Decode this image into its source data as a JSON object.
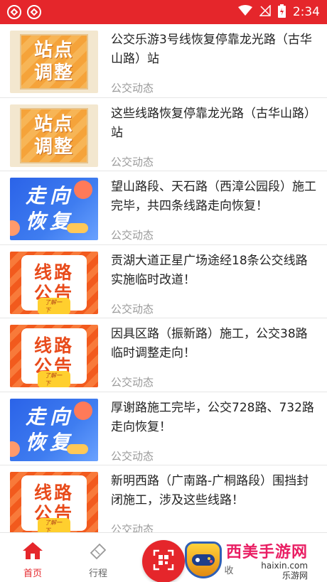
{
  "status_bar": {
    "time": "2:34",
    "icons": [
      "app-notification-icon",
      "app-notification-icon",
      "wifi-icon",
      "signal-off-icon",
      "battery-charging-icon"
    ]
  },
  "news": [
    {
      "title": "公交乐游3号线恢复停靠龙光路（古华山路）站",
      "category": "公交动态",
      "thumb": {
        "type": "station",
        "lines": [
          "站点",
          "调整"
        ]
      }
    },
    {
      "title": "这些线路恢复停靠龙光路（古华山路）站",
      "category": "公交动态",
      "thumb": {
        "type": "station",
        "lines": [
          "站点",
          "调整"
        ]
      }
    },
    {
      "title": "望山路段、天石路（西漳公园段）施工完毕，共四条线路走向恢复！",
      "category": "公交动态",
      "thumb": {
        "type": "recover",
        "lines": [
          "走向",
          "恢复"
        ]
      }
    },
    {
      "title": "贡湖大道正星广场途经18条公交线路实施临时改道！",
      "category": "公交动态",
      "thumb": {
        "type": "notice",
        "lines": [
          "线路",
          "公告"
        ],
        "pill": "了解一下"
      }
    },
    {
      "title": "因具区路（振新路）施工，公交38路临时调整走向！",
      "category": "公交动态",
      "thumb": {
        "type": "notice",
        "lines": [
          "线路",
          "公告"
        ],
        "pill": "了解一下"
      }
    },
    {
      "title": "厚谢路施工完毕，公交728路、732路走向恢复！",
      "category": "公交动态",
      "thumb": {
        "type": "recover",
        "lines": [
          "走向",
          "恢复"
        ]
      }
    },
    {
      "title": "新明西路（广南路-广桐路段）围挡封闭施工，涉及这些线路！",
      "category": "公交动态",
      "thumb": {
        "type": "notice",
        "lines": [
          "线路",
          "公告"
        ],
        "pill": "了解一下"
      }
    }
  ],
  "tabbar": {
    "home_label": "首页",
    "trip_label": "行程",
    "partial_label": "收"
  },
  "watermark": {
    "name": "西美手游网",
    "domain": "haixin.com",
    "sub": "乐游网"
  },
  "colors": {
    "accent": "#e5262b",
    "text": "#222222",
    "muted": "#9a9a9a"
  }
}
